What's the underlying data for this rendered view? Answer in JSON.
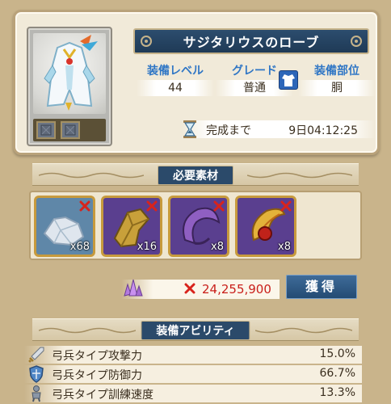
{
  "item": {
    "name": "サジタリウスのローブ"
  },
  "stats": {
    "level": {
      "label": "装備レベル",
      "value": "44"
    },
    "grade": {
      "label": "グレード",
      "value": "普通"
    },
    "slot": {
      "label": "装備部位",
      "value": "胴"
    }
  },
  "completion": {
    "label": "完成まで",
    "value": "9日04:12:25"
  },
  "materials": {
    "header": "必要素材",
    "items": [
      {
        "name": "crystal-ore",
        "count": "x68"
      },
      {
        "name": "gold-bracer",
        "count": "x16"
      },
      {
        "name": "purple-horn",
        "count": "x8"
      },
      {
        "name": "phoenix-feather-gem",
        "count": "x8"
      }
    ]
  },
  "cost": {
    "value": "24,255,900"
  },
  "obtain_button": {
    "label": "獲得"
  },
  "abilities": {
    "header": "装備アビリティ",
    "rows": [
      {
        "name": "弓兵タイプ攻撃力",
        "value": "15.0%",
        "icon": "sword-icon"
      },
      {
        "name": "弓兵タイプ防御力",
        "value": "66.7%",
        "icon": "shield-icon"
      },
      {
        "name": "弓兵タイプ訓練速度",
        "value": "13.3%",
        "icon": "soldier-icon"
      }
    ]
  },
  "colors": {
    "accent_blue": "#2f76c5",
    "cost_red": "#c9201b",
    "banner_navy": "#2b4a6a"
  }
}
